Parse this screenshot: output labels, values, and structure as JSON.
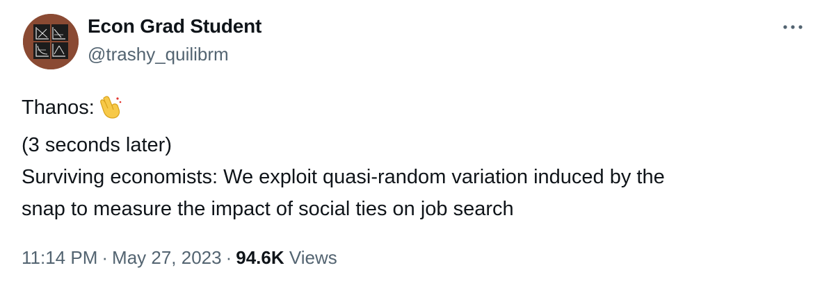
{
  "author": {
    "display_name": "Econ Grad Student",
    "handle": "@trashy_quilibrm",
    "avatar_icon": "economics-graphs-avatar-icon"
  },
  "more_icon": "ellipsis-icon",
  "tweet": {
    "lines": [
      "Thanos:",
      "(3 seconds later)",
      "Surviving economists: We exploit quasi-random variation induced by the",
      "snap to measure the impact of social ties on job search"
    ],
    "emoji_icon": "finger-snap-icon"
  },
  "meta": {
    "time": "11:14 PM",
    "separator": "·",
    "date": "May 27, 2023",
    "views_count": "94.6K",
    "views_label": "Views"
  },
  "colors": {
    "text_primary": "#0f1419",
    "text_secondary": "#536471",
    "avatar_bg": "#8a4a33",
    "emoji_yellow": "#f7c948"
  }
}
